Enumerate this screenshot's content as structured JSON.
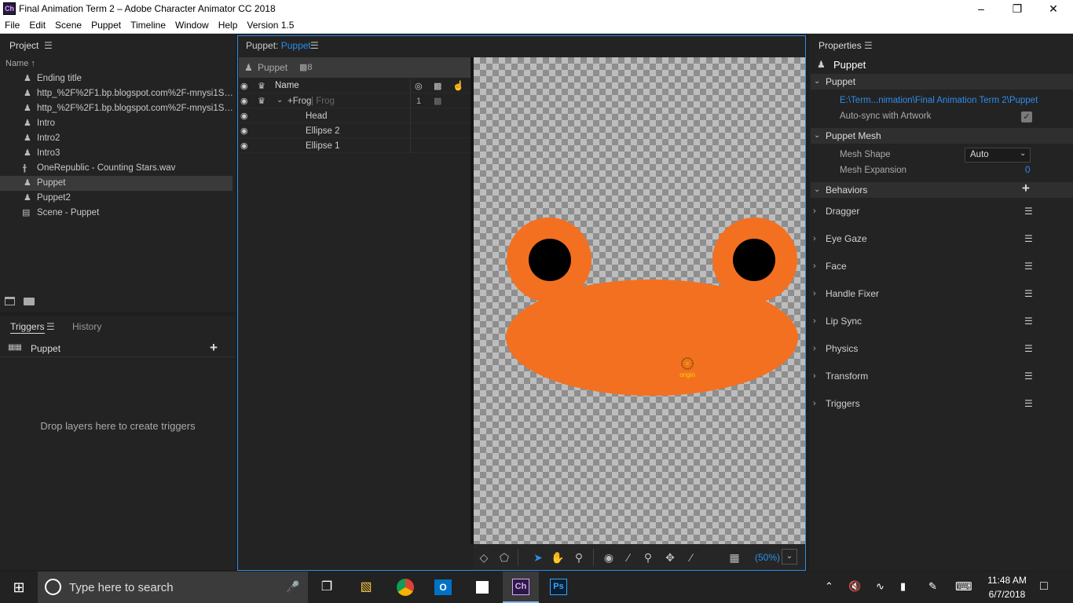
{
  "window": {
    "title": "Final Animation Term 2 – Adobe Character Animator CC 2018",
    "app_icon": "Ch"
  },
  "menu": [
    "File",
    "Edit",
    "Scene",
    "Puppet",
    "Timeline",
    "Window",
    "Help",
    "Version 1.5"
  ],
  "project": {
    "title": "Project",
    "column_name": "Name",
    "items": [
      {
        "label": "Ending title",
        "icon": "puppet-icon"
      },
      {
        "label": "http_%2F%2F1.bp.blogspot.com%2F-mnysi1S…",
        "icon": "puppet-icon"
      },
      {
        "label": "http_%2F%2F1.bp.blogspot.com%2F-mnysi1S…",
        "icon": "puppet-icon"
      },
      {
        "label": "Intro",
        "icon": "puppet-icon"
      },
      {
        "label": "Intro2",
        "icon": "puppet-icon"
      },
      {
        "label": "Intro3",
        "icon": "puppet-icon"
      },
      {
        "label": "OneRepublic - Counting Stars.wav",
        "icon": "audio-icon"
      },
      {
        "label": "Puppet",
        "icon": "puppet-icon"
      },
      {
        "label": "Puppet2",
        "icon": "puppet-icon"
      },
      {
        "label": "Scene - Puppet",
        "icon": "scene-icon"
      }
    ]
  },
  "triggers": {
    "tab_triggers": "Triggers",
    "tab_history": "History",
    "row_label": "Puppet",
    "empty_message": "Drop layers here to create triggers"
  },
  "puppet_panel": {
    "title_prefix": "Puppet:",
    "title_name": "Puppet",
    "header_name": "Puppet",
    "header_count": "8",
    "column_name": "Name",
    "layers": [
      {
        "name": "+Frog",
        "sub": "Frog",
        "count": "1"
      },
      {
        "name": "Head"
      },
      {
        "name": "Ellipse 2"
      },
      {
        "name": "Ellipse 1"
      }
    ]
  },
  "canvas": {
    "origin_label": "origin",
    "zoom": "(50%)"
  },
  "properties": {
    "title": "Properties",
    "object_name": "Puppet",
    "puppet_section": "Puppet",
    "path": "E:\\Term...nimation\\Final Animation Term 2\\Puppet",
    "autosync_label": "Auto-sync with Artwork",
    "mesh_section": "Puppet Mesh",
    "mesh_shape_label": "Mesh Shape",
    "mesh_shape_value": "Auto",
    "mesh_expansion_label": "Mesh Expansion",
    "mesh_expansion_value": "0",
    "behaviors_section": "Behaviors",
    "behaviors": [
      "Dragger",
      "Eye Gaze",
      "Face",
      "Handle Fixer",
      "Lip Sync",
      "Physics",
      "Transform",
      "Triggers"
    ]
  },
  "taskbar": {
    "search_placeholder": "Type here to search",
    "time": "11:48 AM",
    "date": "6/7/2018"
  },
  "colors": {
    "frog": "#f37021",
    "accent": "#2d8ceb",
    "panel": "#232323"
  }
}
